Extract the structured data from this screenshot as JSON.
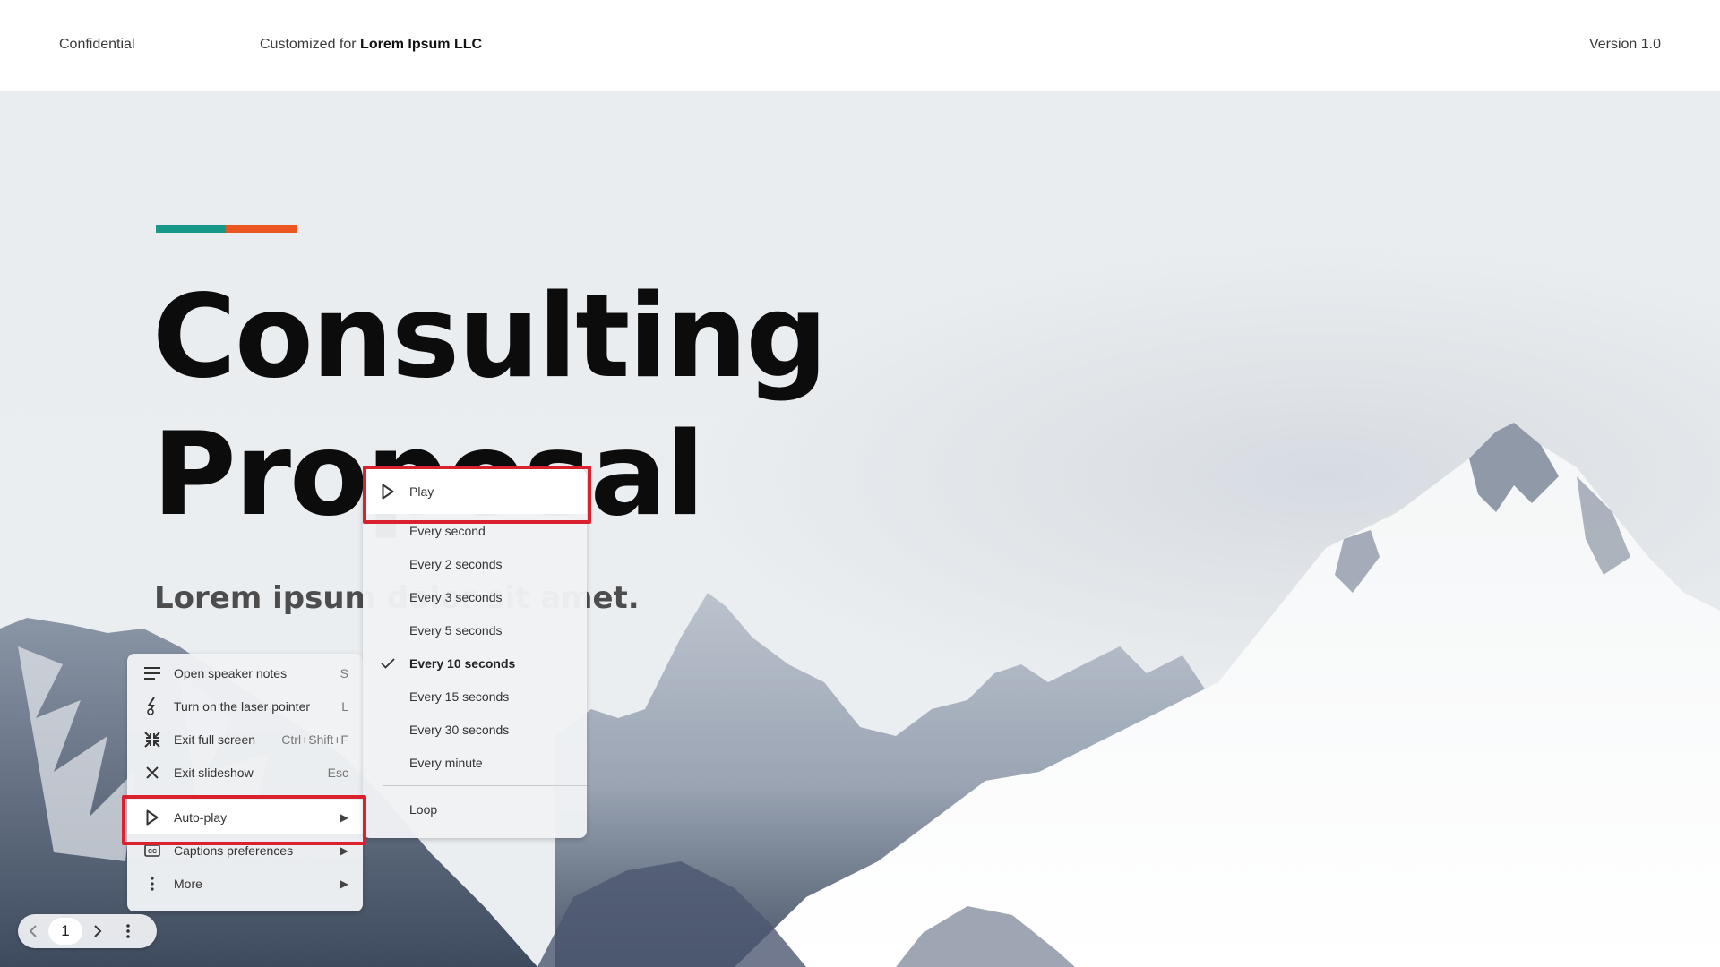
{
  "header": {
    "confidential": "Confidential",
    "customized_prefix": "Customized for ",
    "customized_client": "Lorem Ipsum LLC",
    "version": "Version 1.0"
  },
  "slide": {
    "title_line1": "Consulting",
    "title_line2": "Proposal",
    "subtitle": "Lorem ipsum dolor sit amet.",
    "accent_colors": {
      "teal": "#17998a",
      "orange": "#ea5520"
    }
  },
  "toolbar": {
    "prev_icon": "chevron-left-icon",
    "page_number": "1",
    "next_icon": "chevron-right-icon",
    "more_icon": "more-vert-icon"
  },
  "main_menu": {
    "items": [
      {
        "label": "Open speaker notes",
        "shortcut": "S",
        "icon": "speaker-notes-icon"
      },
      {
        "label": "Turn on the laser pointer",
        "shortcut": "L",
        "icon": "laser-pointer-icon"
      },
      {
        "label": "Exit full screen",
        "shortcut": "Ctrl+Shift+F",
        "icon": "exit-fullscreen-icon"
      },
      {
        "label": "Exit slideshow",
        "shortcut": "Esc",
        "icon": "close-icon"
      },
      {
        "label": "Auto-play",
        "submenu": true,
        "icon": "play-icon"
      },
      {
        "label": "Captions preferences",
        "submenu": true,
        "icon": "captions-icon"
      },
      {
        "label": "More",
        "submenu": true,
        "icon": "more-vert-icon"
      }
    ]
  },
  "autoplay_menu": {
    "play": {
      "label": "Play",
      "icon": "play-icon"
    },
    "intervals": [
      {
        "label": "Every second"
      },
      {
        "label": "Every 2 seconds"
      },
      {
        "label": "Every 3 seconds"
      },
      {
        "label": "Every 5 seconds"
      },
      {
        "label": "Every 10 seconds",
        "selected": true
      },
      {
        "label": "Every 15 seconds"
      },
      {
        "label": "Every 30 seconds"
      },
      {
        "label": "Every minute"
      }
    ],
    "loop": {
      "label": "Loop"
    }
  },
  "highlight_color": "#d9222d"
}
